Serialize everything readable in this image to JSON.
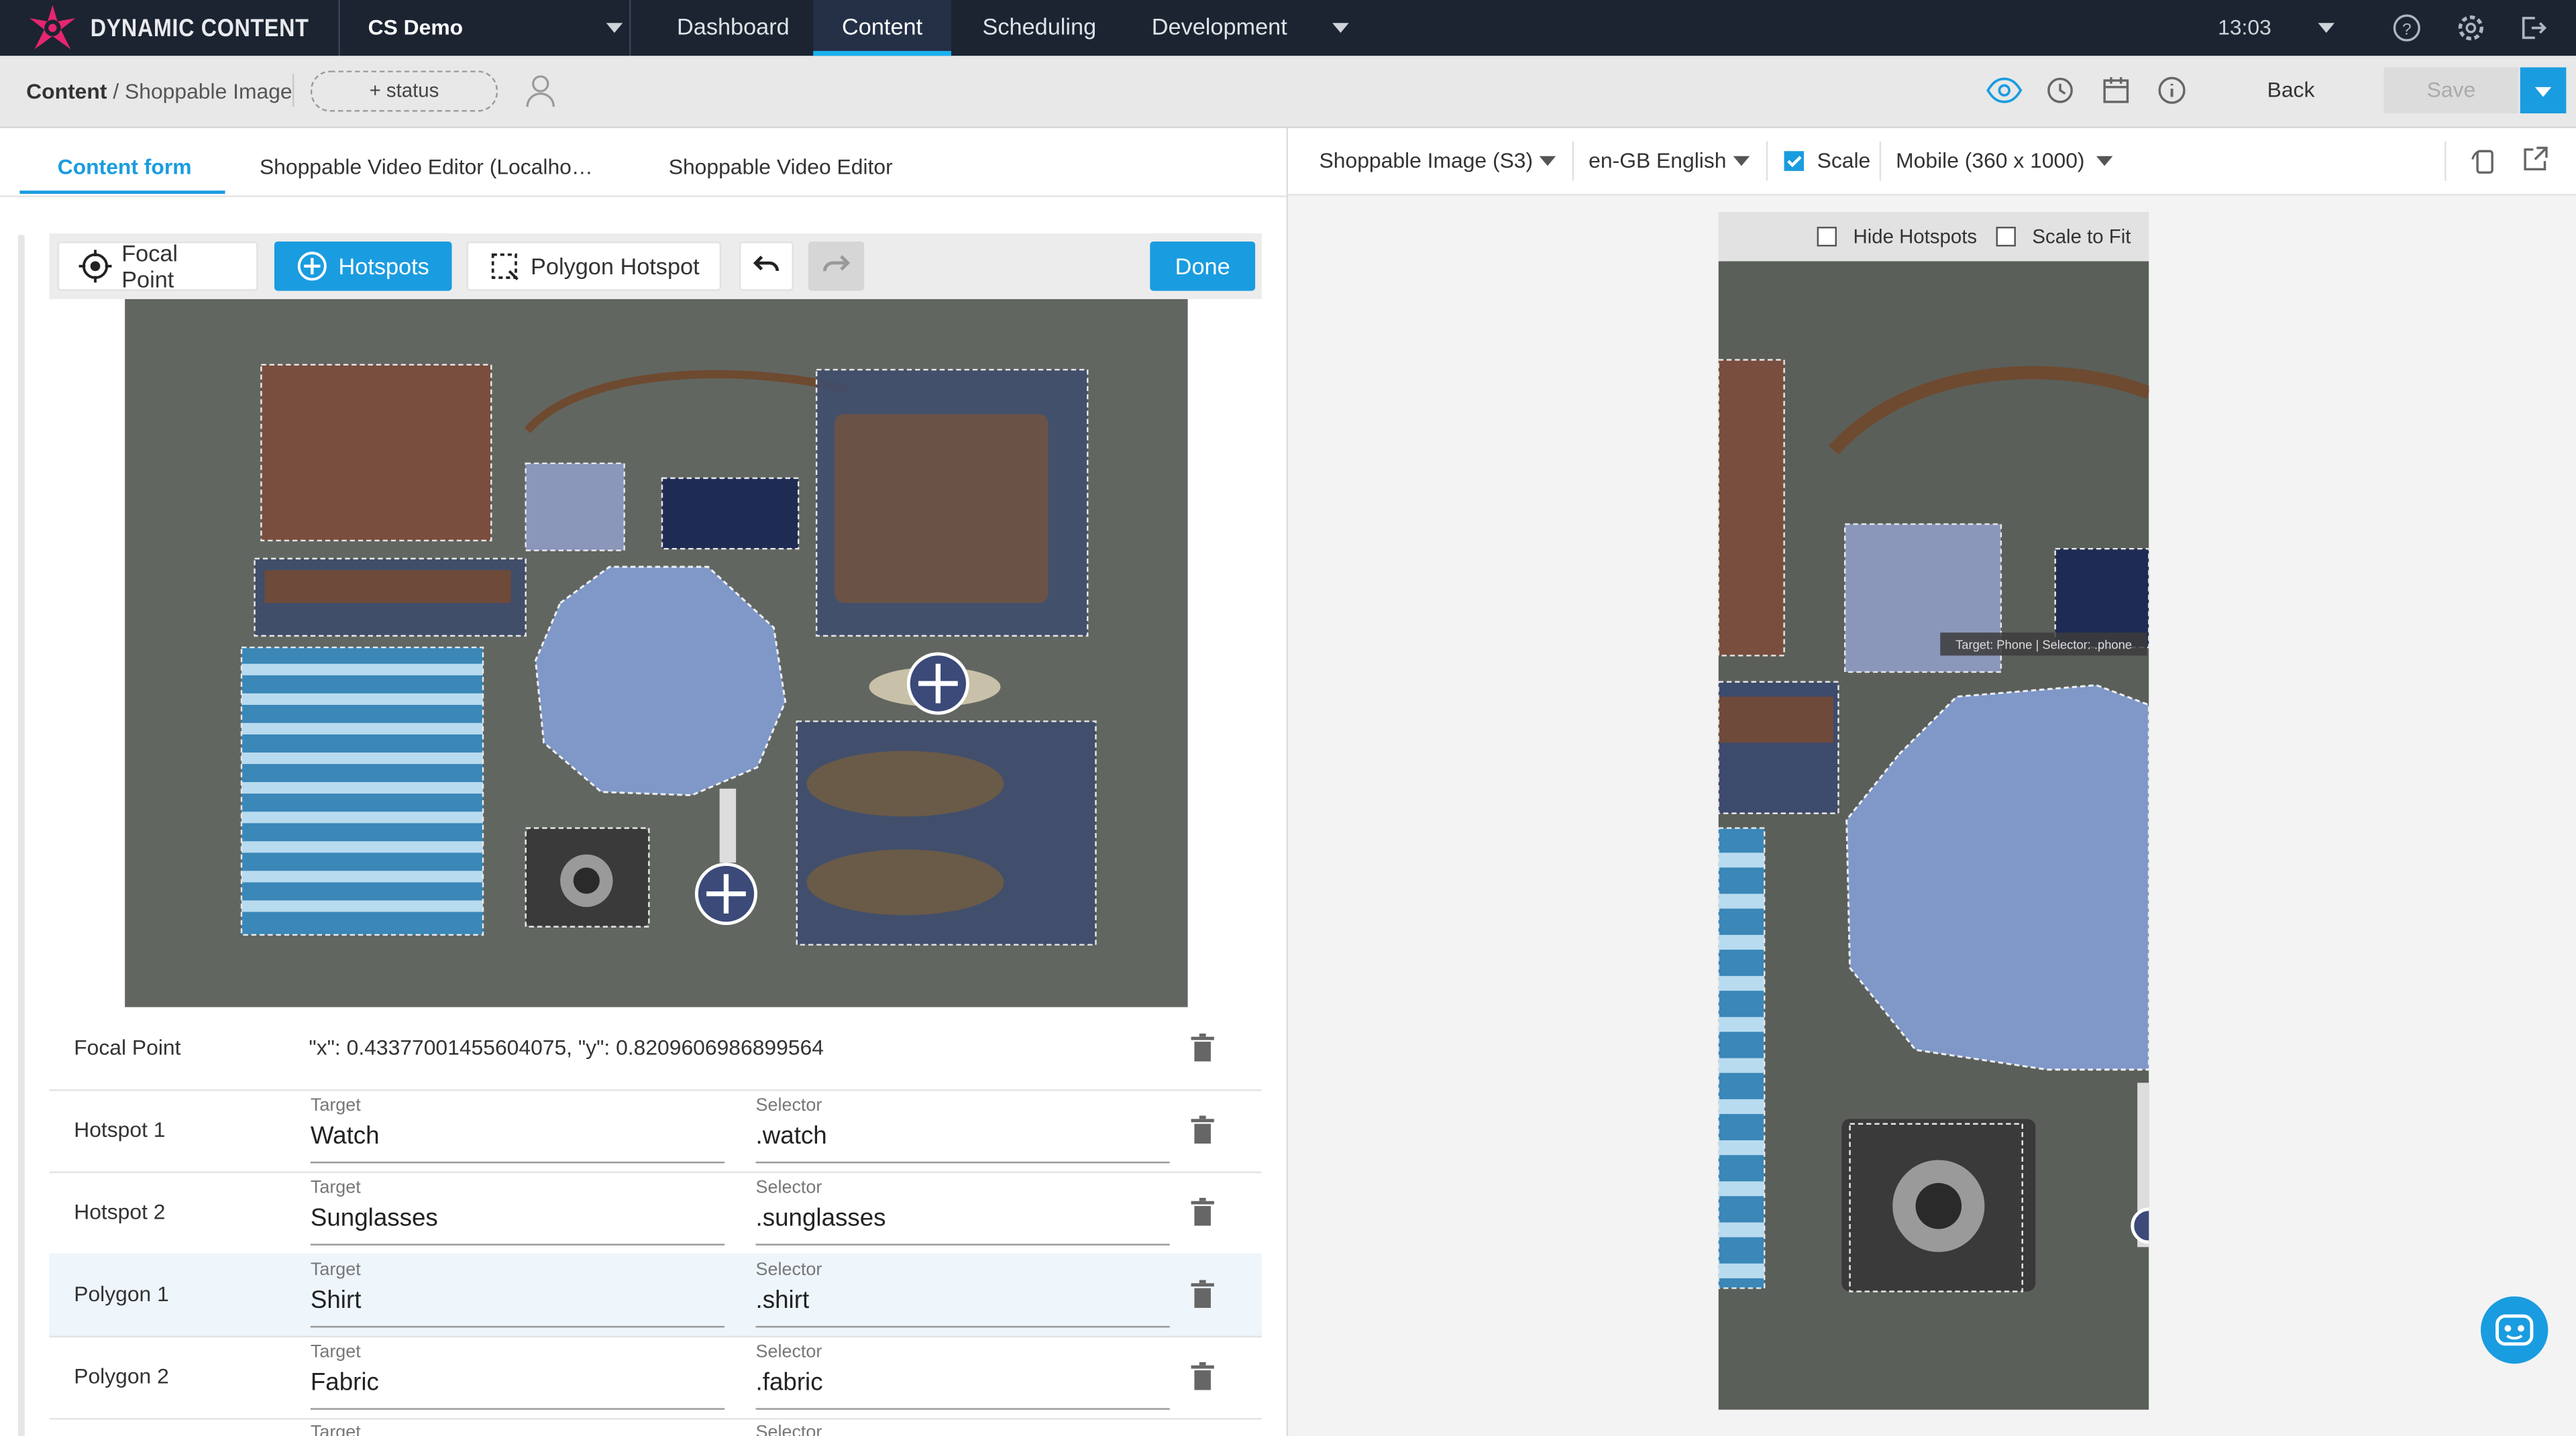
{
  "topbar": {
    "brand": "DYNAMIC CONTENT",
    "hub": "CS Demo",
    "nav": [
      "Dashboard",
      "Content",
      "Scheduling",
      "Development"
    ],
    "active_nav": "Content",
    "time": "13:03",
    "icons": [
      "help-icon",
      "settings-icon",
      "logout-icon"
    ]
  },
  "subbar": {
    "breadcrumb_root": "Content",
    "breadcrumb_leaf": "/ Shoppable Image",
    "status_button": "+ status",
    "back": "Back",
    "save": "Save",
    "icons": [
      "preview-eye-icon",
      "history-icon",
      "calendar-icon",
      "info-icon",
      "user-icon"
    ]
  },
  "left": {
    "tabs": [
      "Content form",
      "Shoppable Video Editor (Localho…",
      "Shoppable Video Editor"
    ],
    "toolbar": {
      "focal_point": "Focal Point",
      "hotspots": "Hotspots",
      "polygon": "Polygon Hotspot",
      "done": "Done"
    },
    "focal_point_label": "Focal Point",
    "focal_point_value": "\"x\": 0.43377001455604075, \"y\": 0.8209606986899564",
    "field_labels": {
      "target": "Target",
      "selector": "Selector"
    },
    "rows": [
      {
        "label": "Hotspot 1",
        "target": "Watch",
        "selector": ".watch"
      },
      {
        "label": "Hotspot 2",
        "target": "Sunglasses",
        "selector": ".sunglasses"
      },
      {
        "label": "Polygon 1",
        "target": "Shirt",
        "selector": ".shirt"
      },
      {
        "label": "Polygon 2",
        "target": "Fabric",
        "selector": ".fabric"
      }
    ]
  },
  "right": {
    "content_type": "Shoppable Image (S3)",
    "locale": "en-GB English",
    "scale_label": "Scale",
    "scale_checked": true,
    "device": "Mobile (360 x 1000)",
    "hide_hotspots": "Hide Hotspots",
    "scale_to_fit": "Scale to Fit",
    "tooltip": "Target: Phone | Selector: .phone"
  },
  "colors": {
    "accent": "#1a9ce0",
    "topbar": "#1c2431",
    "brand": "#e5266e"
  }
}
